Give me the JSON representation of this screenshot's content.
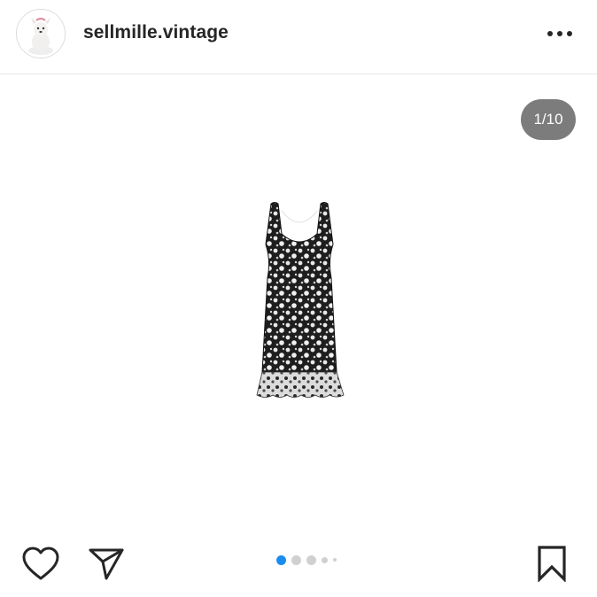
{
  "post": {
    "username": "sellmille.vintage",
    "carousel_counter": "1/10",
    "carousel_position": 1,
    "carousel_total": 10
  },
  "icons": {
    "avatar": "white-dog-avatar",
    "more": "more-options-icon",
    "like": "heart-icon",
    "share": "send-paper-plane-icon",
    "save": "bookmark-icon"
  },
  "colors": {
    "active_dot": "#1a8cf0",
    "inactive_dot": "#d0d0d0",
    "counter_bg": "#6e6e6e",
    "text": "#262626"
  }
}
